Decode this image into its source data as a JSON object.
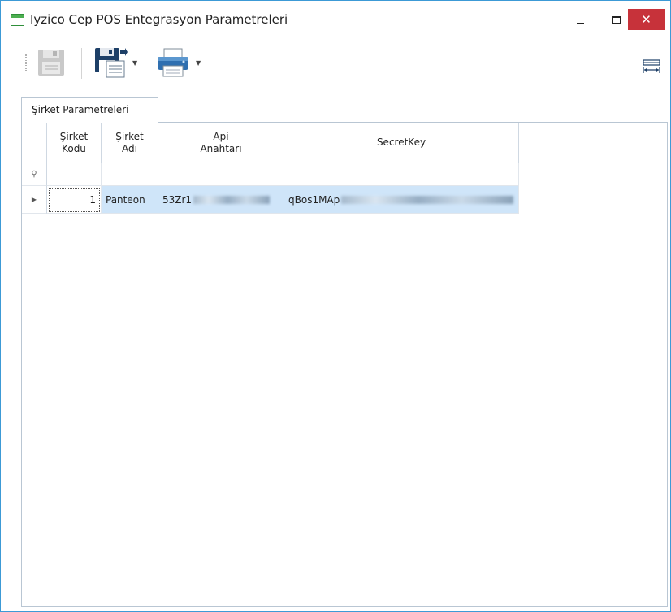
{
  "window": {
    "title": "Iyzico Cep POS Entegrasyon Parametreleri",
    "close_glyph": "✕",
    "accent_color": "#3c9ad6",
    "close_color": "#c7323a"
  },
  "toolbar": {
    "buttons": [
      {
        "icon": "floppy-disk-icon",
        "state": "disabled"
      },
      {
        "icon": "save-as-icon",
        "has_dropdown": true
      },
      {
        "icon": "printer-icon",
        "has_dropdown": true
      },
      {
        "icon": "layout-icon"
      }
    ],
    "dropdown_glyph": "▼"
  },
  "tabs": [
    {
      "label": "Şirket Parametreleri",
      "active": true
    }
  ],
  "grid": {
    "columns": [
      {
        "label": "Şirket\nKodu"
      },
      {
        "label": "Şirket\nAdı"
      },
      {
        "label": "Api\nAnahtarı"
      },
      {
        "label": "SecretKey"
      }
    ],
    "filter_row_icon": "⚲",
    "row_indicator_glyph": "▶",
    "rows": [
      {
        "sirket_kodu": "1",
        "sirket_adi": "Panteon",
        "api_anahtari": "53Zr1",
        "secret_key": "qBos1MAp"
      }
    ],
    "selection_color": "#cfe5f9"
  }
}
